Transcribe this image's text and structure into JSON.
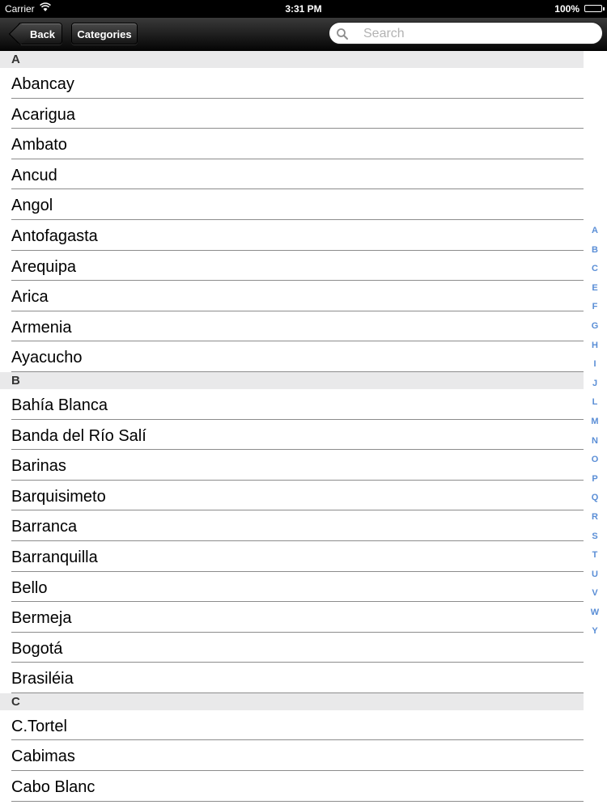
{
  "status_bar": {
    "carrier": "Carrier",
    "time": "3:31 PM",
    "battery": "100%"
  },
  "nav_bar": {
    "back_label": "Back",
    "categories_label": "Categories",
    "search_placeholder": "Search",
    "search_value": ""
  },
  "sections": [
    {
      "header": "A",
      "items": [
        "Abancay",
        "Acarigua",
        "Ambato",
        "Ancud",
        "Angol",
        "Antofagasta",
        "Arequipa",
        "Arica",
        "Armenia",
        "Ayacucho"
      ]
    },
    {
      "header": "B",
      "items": [
        "Bahía Blanca",
        "Banda del Río Salí",
        "Barinas",
        "Barquisimeto",
        "Barranca",
        "Barranquilla",
        "Bello",
        "Bermeja",
        "Bogotá",
        "Brasiléia"
      ]
    },
    {
      "header": "C",
      "items": [
        "C.Tortel",
        "Cabimas",
        "Cabo Blanc"
      ]
    }
  ],
  "index_letters": [
    "A",
    "B",
    "C",
    "E",
    "F",
    "G",
    "H",
    "I",
    "J",
    "L",
    "M",
    "N",
    "O",
    "P",
    "Q",
    "R",
    "S",
    "T",
    "U",
    "V",
    "W",
    "Y"
  ],
  "colors": {
    "index_accent": "#5a8ed6",
    "section_header_bg": "#e9e9ea"
  }
}
